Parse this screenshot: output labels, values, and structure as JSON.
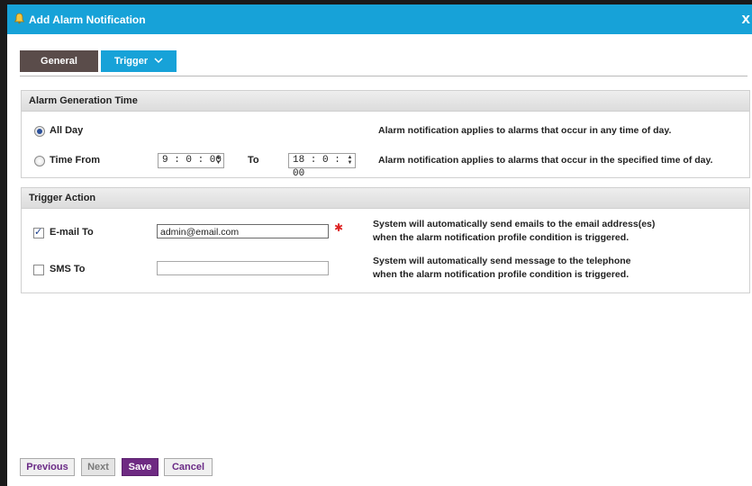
{
  "dialog": {
    "title": "Add Alarm Notification",
    "close_label": "x"
  },
  "tabs": {
    "general": "General",
    "trigger": "Trigger"
  },
  "generation_time": {
    "heading": "Alarm Generation Time",
    "all_day": {
      "label": "All Day",
      "selected": true,
      "description": "Alarm notification applies to alarms that occur in any time of day."
    },
    "time_from": {
      "label": "Time From",
      "selected": false,
      "from_value": "9 : 0 : 00",
      "to_label": "To",
      "to_value": "18 : 0 : 00",
      "description": "Alarm notification applies to alarms that occur in the specified time of day."
    }
  },
  "trigger_action": {
    "heading": "Trigger Action",
    "email": {
      "label": "E-mail To",
      "checked": true,
      "value": "admin@email.com",
      "description_line1": "System will automatically send emails to the email address(es)",
      "description_line2": "when the alarm notification profile condition is triggered."
    },
    "sms": {
      "label": "SMS To",
      "checked": false,
      "value": "",
      "description_line1": "System will automatically send message to the telephone",
      "description_line2": "when the alarm notification profile condition is triggered."
    }
  },
  "buttons": {
    "previous": "Previous",
    "next": "Next",
    "save": "Save",
    "cancel": "Cancel"
  },
  "colors": {
    "title_bar": "#17a2d8",
    "active_tab": "#17a2d8",
    "inactive_tab": "#5a4c4a",
    "save_button": "#6e2a82"
  }
}
